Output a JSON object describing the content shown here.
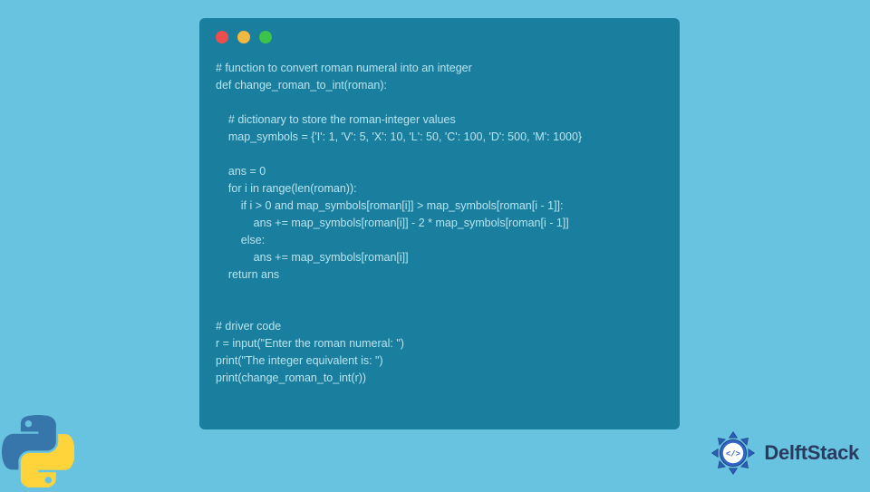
{
  "code_window": {
    "lines": [
      "# function to convert roman numeral into an integer",
      "def change_roman_to_int(roman):",
      "",
      "    # dictionary to store the roman-integer values",
      "    map_symbols = {'I': 1, 'V': 5, 'X': 10, 'L': 50, 'C': 100, 'D': 500, 'M': 1000}",
      "",
      "    ans = 0",
      "    for i in range(len(roman)):",
      "        if i > 0 and map_symbols[roman[i]] > map_symbols[roman[i - 1]]:",
      "            ans += map_symbols[roman[i]] - 2 * map_symbols[roman[i - 1]]",
      "        else:",
      "            ans += map_symbols[roman[i]]",
      "    return ans",
      "",
      "",
      "# driver code",
      "r = input(\"Enter the roman numeral: \")",
      "print(\"The integer equivalent is: \")",
      "print(change_roman_to_int(r))"
    ]
  },
  "brand": {
    "name": "DelftStack"
  },
  "colors": {
    "background": "#68c3e0",
    "window": "#1a7f9e",
    "code_text": "#b8e4f0",
    "dot_red": "#ec4d4d",
    "dot_yellow": "#f0b840",
    "dot_green": "#3dc24a"
  }
}
